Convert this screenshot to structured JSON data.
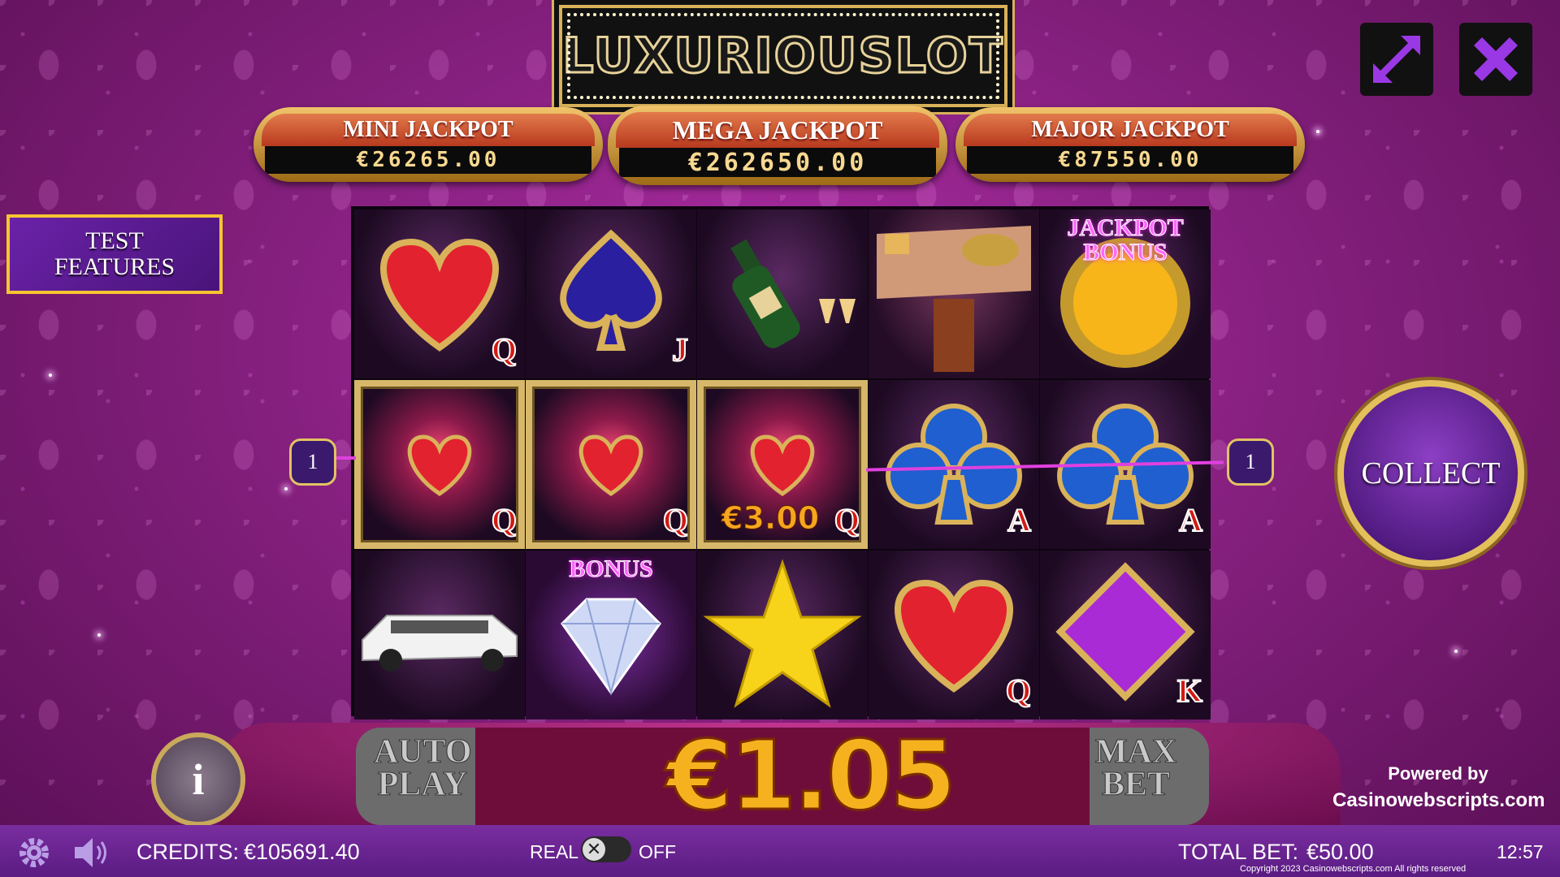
{
  "logo": {
    "text": "LUXURIOUSLOT"
  },
  "jackpots": [
    {
      "label": "MINI JACKPOT",
      "amount": "€26265.00"
    },
    {
      "label": "MEGA JACKPOT",
      "amount": "€262650.00"
    },
    {
      "label": "MAJOR JACKPOT",
      "amount": "€87550.00"
    }
  ],
  "test_features": {
    "label_line1": "TEST",
    "label_line2": "FEATURES"
  },
  "reels": {
    "row1": [
      {
        "symbol": "heart-red",
        "letter": "Q"
      },
      {
        "symbol": "spade-blue",
        "letter": "J"
      },
      {
        "symbol": "champagne"
      },
      {
        "symbol": "table-telephone"
      },
      {
        "symbol": "jackpot-bonus-coin",
        "label_line1": "JACKPOT",
        "label_line2": "BONUS"
      }
    ],
    "row2": [
      {
        "symbol": "heart-small-glow",
        "letter": "Q"
      },
      {
        "symbol": "heart-small-glow",
        "letter": "Q"
      },
      {
        "symbol": "heart-small-glow",
        "letter": "Q",
        "win": "€3.00"
      },
      {
        "symbol": "club-blue",
        "letter": "A"
      },
      {
        "symbol": "club-blue",
        "letter": "A"
      }
    ],
    "row3": [
      {
        "symbol": "limousine"
      },
      {
        "symbol": "diamond-bonus",
        "label": "BONUS"
      },
      {
        "symbol": "gold-star"
      },
      {
        "symbol": "heart-red",
        "letter": "Q"
      },
      {
        "symbol": "diamond-purple",
        "letter": "K"
      }
    ]
  },
  "payline": {
    "left_number": "1",
    "right_number": "1"
  },
  "collect": {
    "label": "COLLECT"
  },
  "bet_panel": {
    "auto_line1": "AUTO",
    "auto_line2": "PLAY",
    "max_line1": "MAX",
    "max_line2": "BET",
    "bet_amount": "€1.05"
  },
  "info": {
    "label": "i"
  },
  "powered": {
    "line1": "Powered by",
    "line2": "Casinowebscripts.com"
  },
  "status": {
    "credits_label": "CREDITS:",
    "credits_value": "€105691.40",
    "real": "REAL",
    "off": "OFF",
    "toggle_glyph": "✕",
    "total_bet_label": "TOTAL BET:",
    "total_bet_value": "€50.00",
    "time": "12:57",
    "copyright": "Copyright 2023 Casinowebscripts.com All rights reserved"
  },
  "colors": {
    "accent_gold": "#e4c05a",
    "purple": "#86207f",
    "bet_orange": "#f6b21e"
  }
}
